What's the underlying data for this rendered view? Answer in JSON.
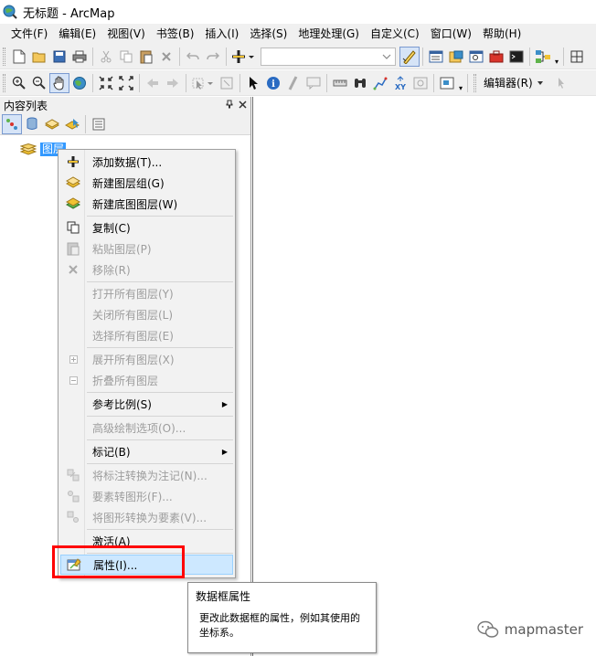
{
  "window": {
    "title": "无标题 - ArcMap"
  },
  "menubar": [
    "文件(F)",
    "编辑(E)",
    "视图(V)",
    "书签(B)",
    "插入(I)",
    "选择(S)",
    "地理处理(G)",
    "自定义(C)",
    "窗口(W)",
    "帮助(H)"
  ],
  "toolbar": {
    "editor_label": "编辑器(R)"
  },
  "toc": {
    "title": "内容列表",
    "pin": "ᵖ",
    "close": "✕",
    "layer_label": "图层"
  },
  "context_menu": {
    "items": [
      {
        "label": "添加数据(T)...",
        "disabled": false
      },
      {
        "label": "新建图层组(G)",
        "disabled": false
      },
      {
        "label": "新建底图图层(W)",
        "disabled": false
      },
      {
        "label": "复制(C)",
        "disabled": false
      },
      {
        "label": "粘贴图层(P)",
        "disabled": true
      },
      {
        "label": "移除(R)",
        "disabled": true
      },
      {
        "label": "打开所有图层(Y)",
        "disabled": true
      },
      {
        "label": "关闭所有图层(L)",
        "disabled": true
      },
      {
        "label": "选择所有图层(E)",
        "disabled": true
      },
      {
        "label": "展开所有图层(X)",
        "disabled": true
      },
      {
        "label": "折叠所有图层",
        "disabled": true
      },
      {
        "label": "参考比例(S)",
        "disabled": false
      },
      {
        "label": "高级绘制选项(O)...",
        "disabled": true
      },
      {
        "label": "标记(B)",
        "disabled": false
      },
      {
        "label": "将标注转换为注记(N)...",
        "disabled": true
      },
      {
        "label": "要素转图形(F)...",
        "disabled": true
      },
      {
        "label": "将图形转换为要素(V)...",
        "disabled": true
      },
      {
        "label": "激活(A)",
        "disabled": false
      },
      {
        "label": "属性(I)...",
        "disabled": false
      }
    ]
  },
  "tooltip": {
    "title": "数据框属性",
    "body": "更改此数据框的属性，例如其使用的坐标系。"
  },
  "watermark": {
    "text": "mapmaster"
  },
  "colors": {
    "selection": "#3399ff",
    "highlight": "#cde8ff",
    "annotation_red": "#ff0000",
    "menu_bg": "#f2f2f2"
  }
}
